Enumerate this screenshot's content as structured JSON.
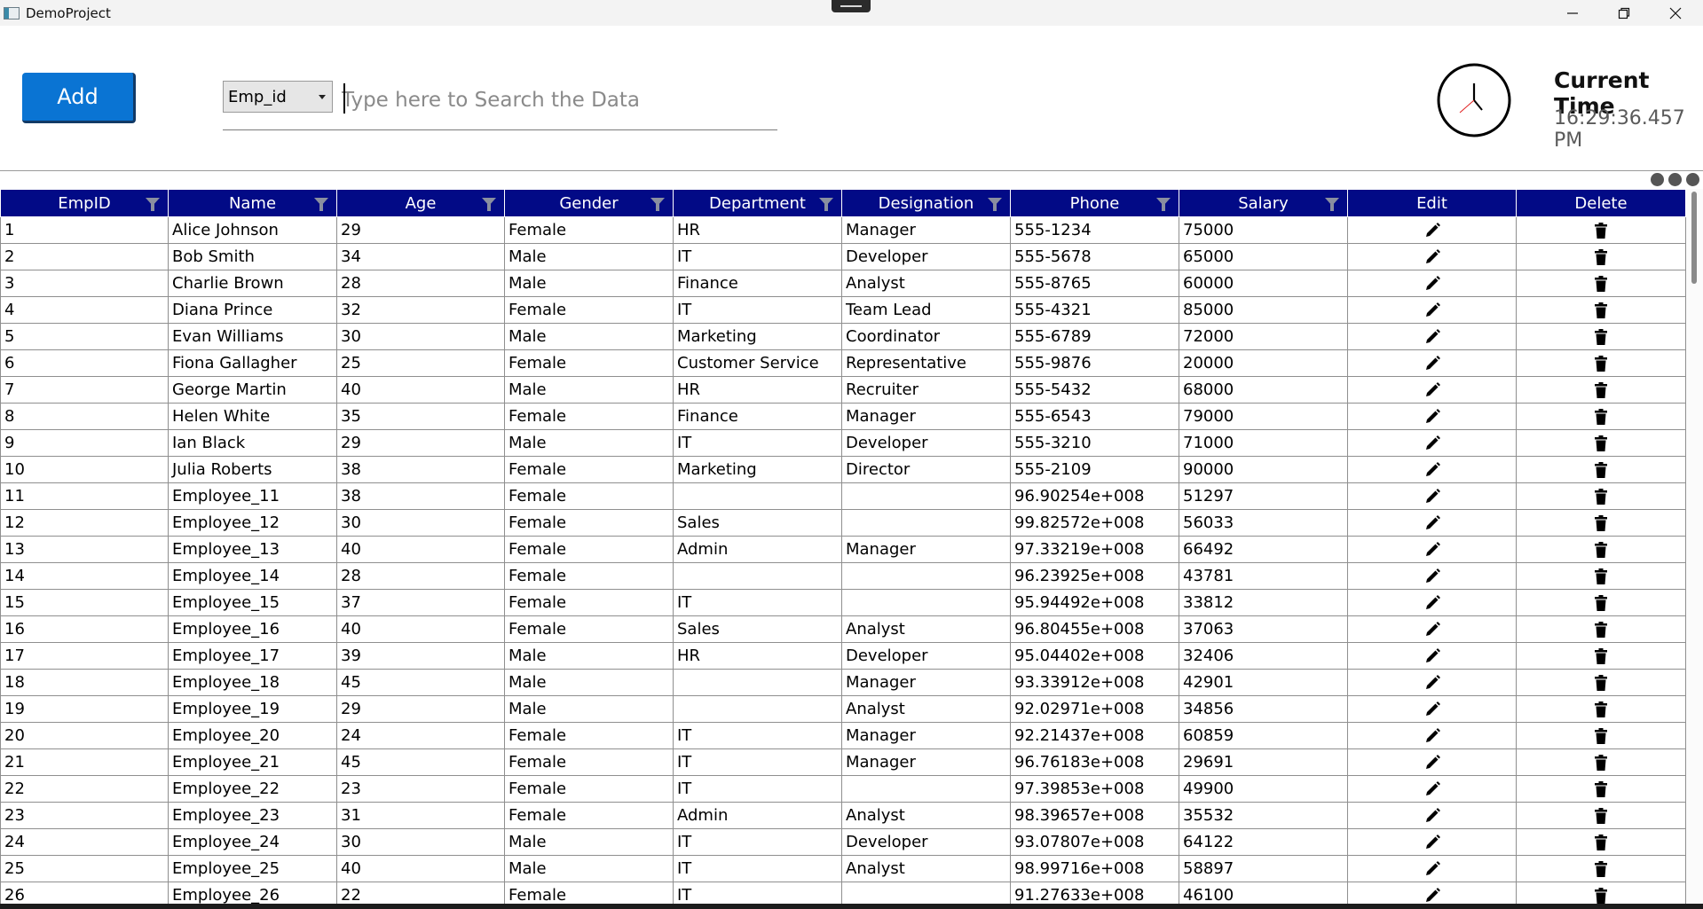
{
  "window": {
    "title": "DemoProject"
  },
  "toolbar": {
    "add_label": "Add",
    "search_field_selected": "Emp_id",
    "search_placeholder": "Type here to Search the Data"
  },
  "clock": {
    "title": "Current Time",
    "time": "16:29:36.457 PM"
  },
  "grid": {
    "columns": [
      "EmpID",
      "Name",
      "Age",
      "Gender",
      "Department",
      "Designation",
      "Phone",
      "Salary",
      "Edit",
      "Delete"
    ],
    "header_color": "#020a86",
    "rows": [
      [
        "1",
        "Alice Johnson",
        "29",
        "Female",
        "HR",
        "Manager",
        "555-1234",
        "75000"
      ],
      [
        "2",
        "Bob Smith",
        "34",
        "Male",
        "IT",
        "Developer",
        "555-5678",
        "65000"
      ],
      [
        "3",
        "Charlie Brown",
        "28",
        "Male",
        "Finance",
        "Analyst",
        "555-8765",
        "60000"
      ],
      [
        "4",
        "Diana Prince",
        "32",
        "Female",
        "IT",
        "Team Lead",
        "555-4321",
        "85000"
      ],
      [
        "5",
        "Evan Williams",
        "30",
        "Male",
        "Marketing",
        "Coordinator",
        "555-6789",
        "72000"
      ],
      [
        "6",
        "Fiona Gallagher",
        "25",
        "Female",
        "Customer Service",
        "Representative",
        "555-9876",
        "20000"
      ],
      [
        "7",
        "George Martin",
        "40",
        "Male",
        "HR",
        "Recruiter",
        "555-5432",
        "68000"
      ],
      [
        "8",
        "Helen White",
        "35",
        "Female",
        "Finance",
        "Manager",
        "555-6543",
        "79000"
      ],
      [
        "9",
        "Ian Black",
        "29",
        "Male",
        "IT",
        "Developer",
        "555-3210",
        "71000"
      ],
      [
        "10",
        "Julia Roberts",
        "38",
        "Female",
        "Marketing",
        "Director",
        "555-2109",
        "90000"
      ],
      [
        "11",
        "Employee_11",
        "38",
        "Female",
        "",
        "",
        "96.90254e+008",
        "51297"
      ],
      [
        "12",
        "Employee_12",
        "30",
        "Female",
        "Sales",
        "",
        "99.82572e+008",
        "56033"
      ],
      [
        "13",
        "Employee_13",
        "40",
        "Female",
        "Admin",
        "Manager",
        "97.33219e+008",
        "66492"
      ],
      [
        "14",
        "Employee_14",
        "28",
        "Female",
        "",
        "",
        "96.23925e+008",
        "43781"
      ],
      [
        "15",
        "Employee_15",
        "37",
        "Female",
        "IT",
        "",
        "95.94492e+008",
        "33812"
      ],
      [
        "16",
        "Employee_16",
        "40",
        "Female",
        "Sales",
        "Analyst",
        "96.80455e+008",
        "37063"
      ],
      [
        "17",
        "Employee_17",
        "39",
        "Male",
        "HR",
        "Developer",
        "95.04402e+008",
        "32406"
      ],
      [
        "18",
        "Employee_18",
        "45",
        "Male",
        "",
        "Manager",
        "93.33912e+008",
        "42901"
      ],
      [
        "19",
        "Employee_19",
        "29",
        "Male",
        "",
        "Analyst",
        "92.02971e+008",
        "34856"
      ],
      [
        "20",
        "Employee_20",
        "24",
        "Female",
        "IT",
        "Manager",
        "92.21437e+008",
        "60859"
      ],
      [
        "21",
        "Employee_21",
        "45",
        "Female",
        "IT",
        "Manager",
        "96.76183e+008",
        "29691"
      ],
      [
        "22",
        "Employee_22",
        "23",
        "Female",
        "IT",
        "",
        "97.39853e+008",
        "49900"
      ],
      [
        "23",
        "Employee_23",
        "31",
        "Female",
        "Admin",
        "Analyst",
        "98.39657e+008",
        "35532"
      ],
      [
        "24",
        "Employee_24",
        "30",
        "Male",
        "IT",
        "Developer",
        "93.07807e+008",
        "64122"
      ],
      [
        "25",
        "Employee_25",
        "40",
        "Male",
        "IT",
        "Analyst",
        "98.99716e+008",
        "58897"
      ],
      [
        "26",
        "Employee_26",
        "22",
        "Female",
        "IT",
        "",
        "91.27633e+008",
        "46100"
      ]
    ]
  }
}
